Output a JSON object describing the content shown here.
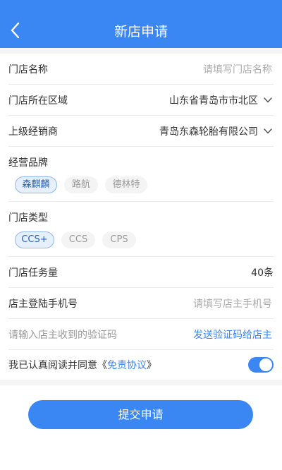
{
  "header": {
    "title": "新店申请"
  },
  "form": {
    "store_name": {
      "label": "门店名称",
      "placeholder": "请填写门店名称"
    },
    "region": {
      "label": "门店所在区域",
      "value": "山东省青岛市市北区"
    },
    "dealer": {
      "label": "上级经销商",
      "value": "青岛东森轮胎有限公司"
    },
    "brands": {
      "label": "经营品牌",
      "options": [
        "森麒麟",
        "路航",
        "德林特"
      ],
      "selected": "森麒麟"
    },
    "store_type": {
      "label": "门店类型",
      "options": [
        "CCS+",
        "CCS",
        "CPS"
      ],
      "selected": "CCS+"
    },
    "quota": {
      "label": "门店任务量",
      "value": "40条"
    },
    "owner_phone": {
      "label": "店主登陆手机号",
      "placeholder": "请填写店主手机号"
    },
    "code": {
      "label": "请输入店主收到的验证码",
      "link": "发送验证码给店主"
    },
    "agreement": {
      "prefix": "我已认真阅读并同意《",
      "link": "免责协议",
      "suffix": "》",
      "checked": true
    }
  },
  "footer": {
    "submit_label": "提交申请"
  },
  "colors": {
    "accent": "#3a86f3",
    "chip_selected_bg": "#e6f0fd",
    "background": "#f5f5f5"
  }
}
